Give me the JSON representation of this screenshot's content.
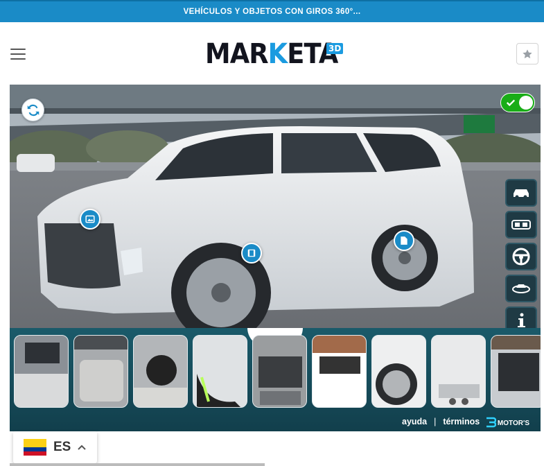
{
  "promo": {
    "text": "VEHÍCULOS Y OBJETOS CON GIROS 360°..."
  },
  "header": {
    "logo_main": "MAR",
    "logo_k": "K",
    "logo_end": "ETA",
    "logo_badge": "3D",
    "menu_icon": "hamburger-icon",
    "favorite_icon": "star-icon"
  },
  "viewer": {
    "rotate_icon": "sync-icon",
    "toggle_on": true,
    "hotspots": [
      {
        "name": "gallery-hotspot",
        "icon": "image-icon"
      },
      {
        "name": "video-hotspot",
        "icon": "film-icon"
      },
      {
        "name": "document-hotspot",
        "icon": "file-icon"
      }
    ],
    "side_menu": [
      "car-exterior-icon",
      "car-interior-icon",
      "steering-wheel-icon",
      "360-view-icon",
      "info-icon"
    ],
    "thumbnails": [
      "Dashboard",
      "Rear seats",
      "Front cockpit",
      "Headlight",
      "Engine",
      "Front view",
      "Wheel",
      "Rear bumper",
      "Trunk"
    ],
    "footer": {
      "help": "ayuda",
      "separator": "|",
      "terms": "términos",
      "brand": "MOTOR'S"
    }
  },
  "language": {
    "code": "ES",
    "flag": "colombia-flag-icon"
  },
  "colors": {
    "accent": "#1a8bc7",
    "toggle": "#19ad17",
    "panel": "#15485a"
  }
}
